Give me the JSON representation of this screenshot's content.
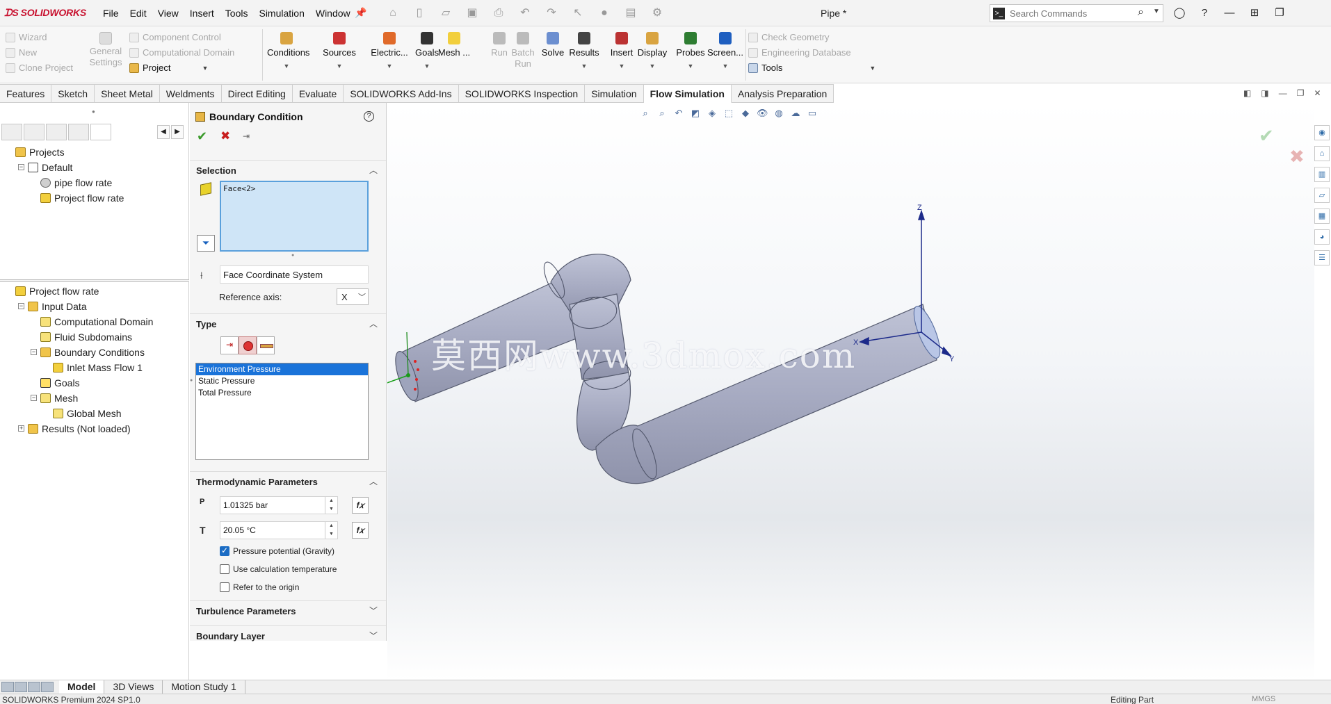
{
  "app": {
    "logo": "SOLIDWORKS",
    "document_title": "Pipe *",
    "menu": [
      "File",
      "Edit",
      "View",
      "Insert",
      "Tools",
      "Simulation",
      "Window"
    ]
  },
  "search": {
    "placeholder": "Search Commands"
  },
  "toolbar": {
    "project_group": {
      "wizard": "Wizard",
      "new": "New",
      "clone_project": "Clone Project",
      "general_settings": "General\nSettings",
      "component_control": "Component Control",
      "computational_domain": "Computational Domain",
      "project": "Project"
    },
    "big": [
      {
        "label": "Conditions",
        "color": "#d9a441",
        "enabled": true
      },
      {
        "label": "Sources",
        "color": "#c33",
        "enabled": true
      },
      {
        "label": "Electric...",
        "color": "#e06a2a",
        "enabled": true
      },
      {
        "label": "Goals",
        "color": "#333",
        "enabled": true
      },
      {
        "label": "Mesh ...",
        "color": "#f2cf3d",
        "enabled": true
      },
      {
        "label": "Run",
        "color": "#bbb",
        "enabled": false
      },
      {
        "label": "Batch\nRun",
        "color": "#bbb",
        "enabled": false
      },
      {
        "label": "Solve",
        "color": "#6c8fd0",
        "enabled": true
      },
      {
        "label": "Results",
        "color": "#444",
        "enabled": true
      },
      {
        "label": "Insert",
        "color": "#b33",
        "enabled": true
      },
      {
        "label": "Display",
        "color": "#d9a441",
        "enabled": true
      },
      {
        "label": "Probes",
        "color": "#2e7d32",
        "enabled": true
      },
      {
        "label": "Screen...",
        "color": "#1f5fc0",
        "enabled": true
      }
    ],
    "right_group": {
      "check_geometry": "Check Geometry",
      "engineering_database": "Engineering Database",
      "tools": "Tools"
    }
  },
  "tabs": [
    "Features",
    "Sketch",
    "Sheet Metal",
    "Weldments",
    "Direct Editing",
    "Evaluate",
    "SOLIDWORKS Add-Ins",
    "SOLIDWORKS Inspection",
    "Simulation",
    "Flow Simulation",
    "Analysis Preparation"
  ],
  "active_tab": "Flow Simulation",
  "tree_top": [
    {
      "label": "Projects",
      "indent": 0,
      "expander": "",
      "icon": "folder"
    },
    {
      "label": "Default",
      "indent": 1,
      "expander": "−",
      "icon": "flag"
    },
    {
      "label": "pipe flow rate",
      "indent": 2,
      "expander": "",
      "icon": "gear"
    },
    {
      "label": "Project flow rate",
      "indent": 2,
      "expander": "",
      "icon": "yellow"
    }
  ],
  "tree_bottom": [
    {
      "label": "Project flow rate",
      "indent": 0,
      "expander": "",
      "icon": "yellow"
    },
    {
      "label": "Input Data",
      "indent": 1,
      "expander": "−",
      "icon": "folder"
    },
    {
      "label": "Computational Domain",
      "indent": 2,
      "expander": "",
      "icon": "mesh"
    },
    {
      "label": "Fluid Subdomains",
      "indent": 2,
      "expander": "",
      "icon": "mesh"
    },
    {
      "label": "Boundary Conditions",
      "indent": 2,
      "expander": "−",
      "icon": "folder"
    },
    {
      "label": "Inlet Mass Flow 1",
      "indent": 3,
      "expander": "",
      "icon": "yellow"
    },
    {
      "label": "Goals",
      "indent": 2,
      "expander": "",
      "icon": "goal"
    },
    {
      "label": "Mesh",
      "indent": 2,
      "expander": "−",
      "icon": "mesh"
    },
    {
      "label": "Global Mesh",
      "indent": 3,
      "expander": "",
      "icon": "mesh"
    },
    {
      "label": "Results (Not loaded)",
      "indent": 1,
      "expander": "+",
      "icon": "folder"
    }
  ],
  "property_manager": {
    "title": "Boundary Condition",
    "selection": {
      "header": "Selection",
      "faces": "Face<2>",
      "coordinate_system": "Face Coordinate System",
      "reference_axis_label": "Reference axis:",
      "reference_axis_value": "X"
    },
    "type": {
      "header": "Type",
      "options": [
        "Environment Pressure",
        "Static Pressure",
        "Total Pressure"
      ],
      "selected": "Environment Pressure"
    },
    "thermo": {
      "header": "Thermodynamic Parameters",
      "pressure": "1.01325 bar",
      "temperature": "20.05 °C",
      "checks": [
        {
          "label": "Pressure potential (Gravity)",
          "checked": true
        },
        {
          "label": "Use calculation temperature",
          "checked": false
        },
        {
          "label": "Refer to the origin",
          "checked": false
        }
      ]
    },
    "turbulence_header": "Turbulence Parameters",
    "boundary_layer_header": "Boundary Layer"
  },
  "viewport": {
    "watermark": "莫西网www.3dmox.com",
    "triad": {
      "x": "X",
      "y": "Y",
      "z": "Z"
    }
  },
  "bottom_tabs": [
    "Model",
    "3D Views",
    "Motion Study 1"
  ],
  "active_bottom_tab": "Model",
  "status": {
    "left": "SOLIDWORKS Premium 2024 SP1.0",
    "middle": "Editing Part",
    "units": "MMGS"
  }
}
